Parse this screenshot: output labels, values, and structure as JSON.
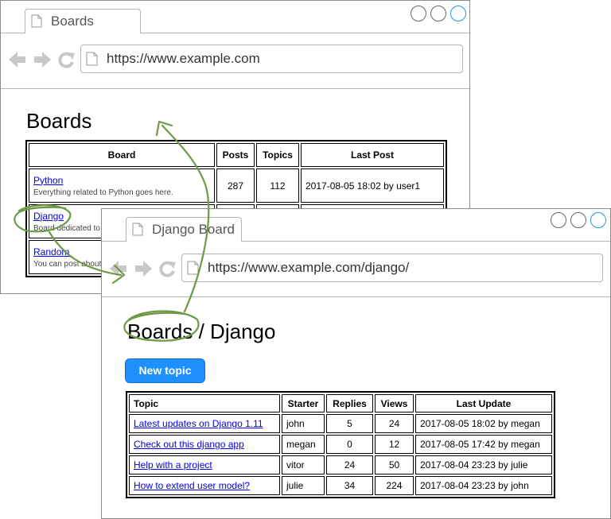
{
  "window_boards": {
    "tab_title": "Boards",
    "url": "https://www.example.com",
    "heading": "Boards",
    "table": {
      "headers": [
        "Board",
        "Posts",
        "Topics",
        "Last Post"
      ],
      "rows": [
        {
          "name": "Python",
          "description": "Everything related to Python goes here.",
          "posts": "287",
          "topics": "112",
          "last_post": "2017-08-05 18:02 by user1"
        },
        {
          "name": "Django",
          "description": "Board dedicated to D",
          "posts": "",
          "topics": "",
          "last_post": ""
        },
        {
          "name": "Random",
          "description": "You can post about e",
          "posts": "",
          "topics": "",
          "last_post": ""
        }
      ]
    }
  },
  "window_django": {
    "tab_title": "Django Board",
    "url": "https://www.example.com/django/",
    "heading": "Boards / Django",
    "new_topic_label": "New topic",
    "table": {
      "headers": [
        "Topic",
        "Starter",
        "Replies",
        "Views",
        "Last Update"
      ],
      "rows": [
        {
          "topic": "Latest updates on Django 1.11",
          "starter": "john",
          "replies": "5",
          "views": "24",
          "last_update": "2017-08-05 18:02 by megan"
        },
        {
          "topic": "Check out this django app",
          "starter": "megan",
          "replies": "0",
          "views": "12",
          "last_update": "2017-08-05 17:42 by megan"
        },
        {
          "topic": "Help with a project",
          "starter": "vitor",
          "replies": "24",
          "views": "50",
          "last_update": "2017-08-04 23:23 by julie"
        },
        {
          "topic": "How to extend user model?",
          "starter": "julie",
          "replies": "34",
          "views": "224",
          "last_update": "2017-08-04 23:23 by john"
        }
      ]
    }
  },
  "colors": {
    "link": "#0000ee",
    "button": "#1e90ff",
    "annotation": "#6e9a45",
    "active_control": "#1a9be6"
  },
  "icons": [
    "document-icon",
    "back-arrow-icon",
    "forward-arrow-icon",
    "reload-icon",
    "window-control-icon"
  ]
}
